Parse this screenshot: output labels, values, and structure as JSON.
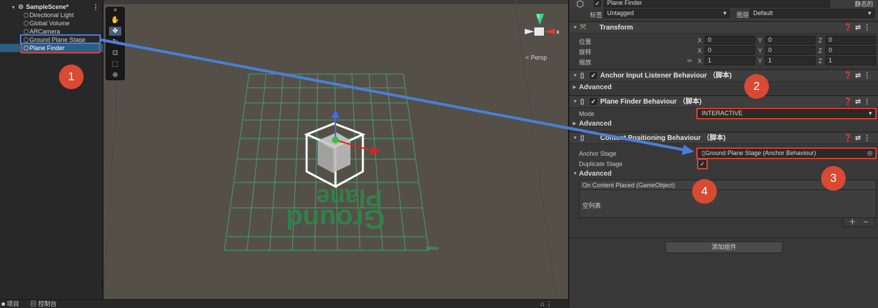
{
  "hierarchy": {
    "scene_name": "SampleScene*",
    "items": [
      "Directional Light",
      "Global Volume",
      "ARCamera",
      "Ground Plane Stage",
      "Plane Finder"
    ]
  },
  "bottom_tabs": {
    "project": "项目",
    "console": "控制台"
  },
  "scene_view": {
    "persp_label": "< Persp",
    "ground_label_line1": "Ground",
    "ground_label_line2": "Plane",
    "scale_label": "100cm",
    "axis_x": "x",
    "axis_z": "z",
    "axis_y": "y"
  },
  "inspector": {
    "object_name": "Plane Finder",
    "static_label": "静态的",
    "tag_label": "标签",
    "tag_value": "Untagged",
    "layer_label": "图层",
    "layer_value": "Default",
    "transform": {
      "title": "Transform",
      "position_label": "位置",
      "rotation_label": "旋转",
      "scale_label": "缩放",
      "x": "X",
      "y": "Y",
      "z": "Z",
      "position": [
        "0",
        "0",
        "0"
      ],
      "rotation": [
        "0",
        "0",
        "0"
      ],
      "scale": [
        "1",
        "1",
        "1"
      ]
    },
    "anchor_input": {
      "title": "Anchor Input Listener Behaviour （脚本)",
      "advanced": "Advanced"
    },
    "plane_finder": {
      "title": "Plane Finder Behaviour （脚本)",
      "mode_label": "Mode",
      "mode_value": "INTERACTIVE",
      "advanced": "Advanced"
    },
    "content_positioning": {
      "title": "Content Positioning Behaviour （脚本)",
      "anchor_stage_label": "Anchor Stage",
      "anchor_stage_value": "Ground Plane Stage (Anchor Behaviour)",
      "duplicate_stage_label": "Duplicate Stage",
      "advanced": "Advanced",
      "event_title": "On Content Placed (GameObject)",
      "empty_list": "空列表"
    },
    "add_component": "添加组件"
  },
  "annotations": [
    "1",
    "2",
    "3",
    "4"
  ],
  "colors": {
    "selection": "#2c5d87",
    "highlight_red": "#d5432f",
    "badge": "#d84a33",
    "arrow": "#4a7fd6",
    "grid": "#3fd28c"
  }
}
